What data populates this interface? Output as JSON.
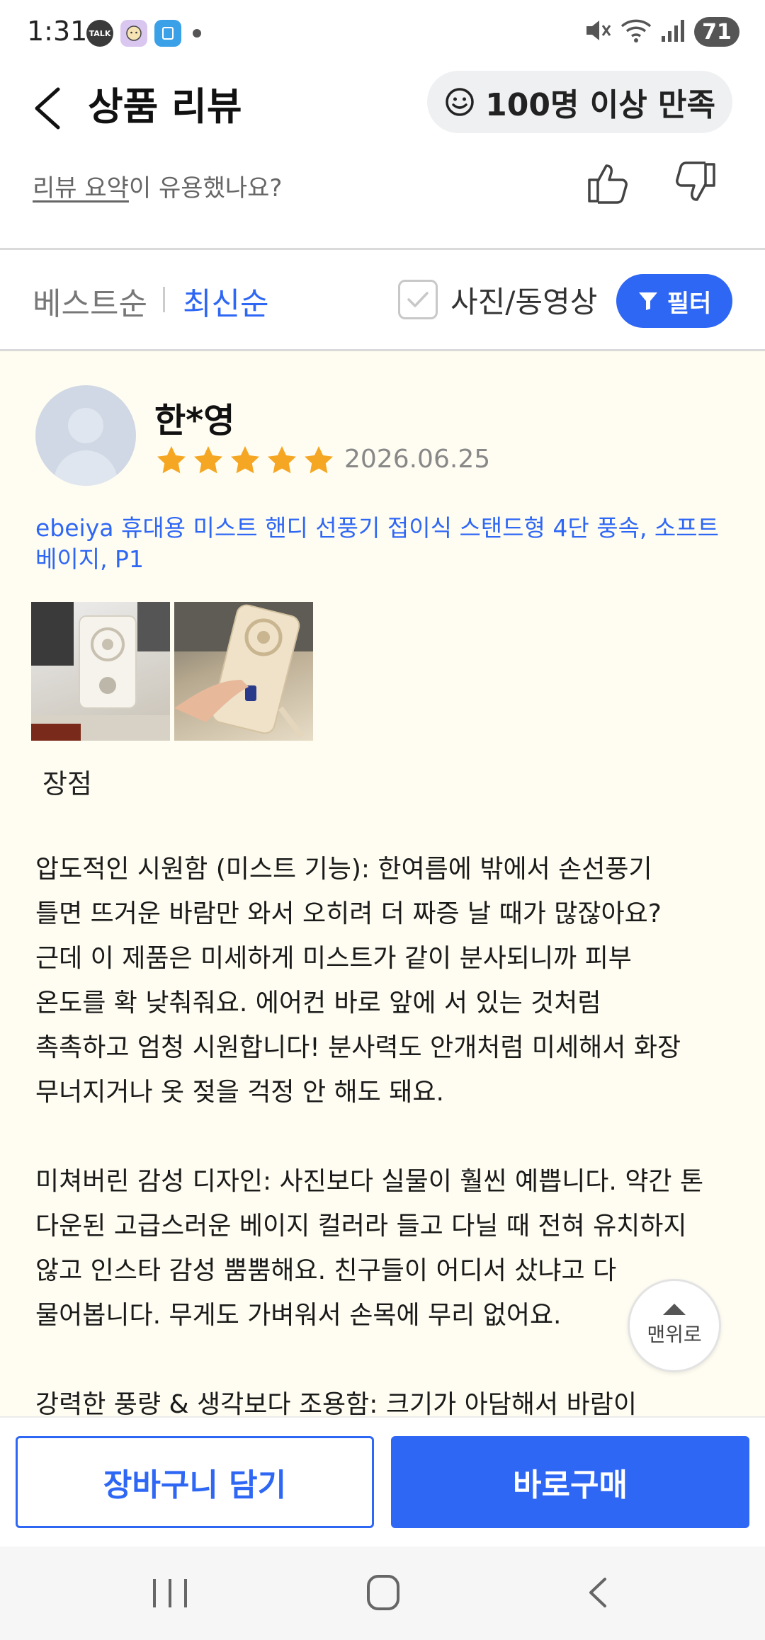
{
  "status_bar": {
    "time": "1:31",
    "talk_badge": "TALK",
    "battery": "71"
  },
  "header": {
    "title": "상품 리뷰",
    "satisfaction_chip": "100명 이상 만족"
  },
  "summary_feedback": {
    "question_underlined": "리뷰 요약",
    "question_rest": "이 유용했나요?"
  },
  "sort": {
    "best": "베스트순",
    "newest": "최신순",
    "photo_video_label": "사진/동영상",
    "filter_label": "필터"
  },
  "review": {
    "reviewer": "한*영",
    "rating": 5,
    "date": "2026.06.25",
    "product_option": "ebeiya 휴대용 미스트 핸디 선풍기 접이식 스탠드형 4단 풍속, 소프트 베이지, P1",
    "photo_count": 2,
    "section_title": "장점",
    "body": "압도적인 시원함 (미스트 기능): 한여름에 밖에서 손선풍기\n틀면 뜨거운 바람만 와서 오히려 더 짜증 날 때가 많잖아요?\n근데 이 제품은 미세하게 미스트가 같이 분사되니까 피부\n온도를 확 낮춰줘요. 에어컨 바로 앞에 서 있는 것처럼\n촉촉하고 엄청 시원합니다! 분사력도 안개처럼 미세해서 화장\n무너지거나 옷 젖을 걱정 안 해도 돼요.\n\n미쳐버린 감성 디자인: 사진보다 실물이 훨씬 예쁩니다. 약간 톤\n다운된 고급스러운 베이지 컬러라 들고 다닐 때 전혀 유치하지\n않고 인스타 감성 뿜뿜해요. 친구들이 어디서 샀냐고 다\n물어봅니다. 무게도 가벼워서 손목에 무리 없어요.\n\n강력한 풍량 & 생각보다 조용함: 크기가 아담해서 바람이"
  },
  "scroll_top_label": "맨위로",
  "actions": {
    "cart": "장바구니 담기",
    "buy": "바로구매"
  },
  "colors": {
    "accent": "#2f67f5",
    "star": "#f5a623",
    "review_bg": "#fffdf1"
  }
}
